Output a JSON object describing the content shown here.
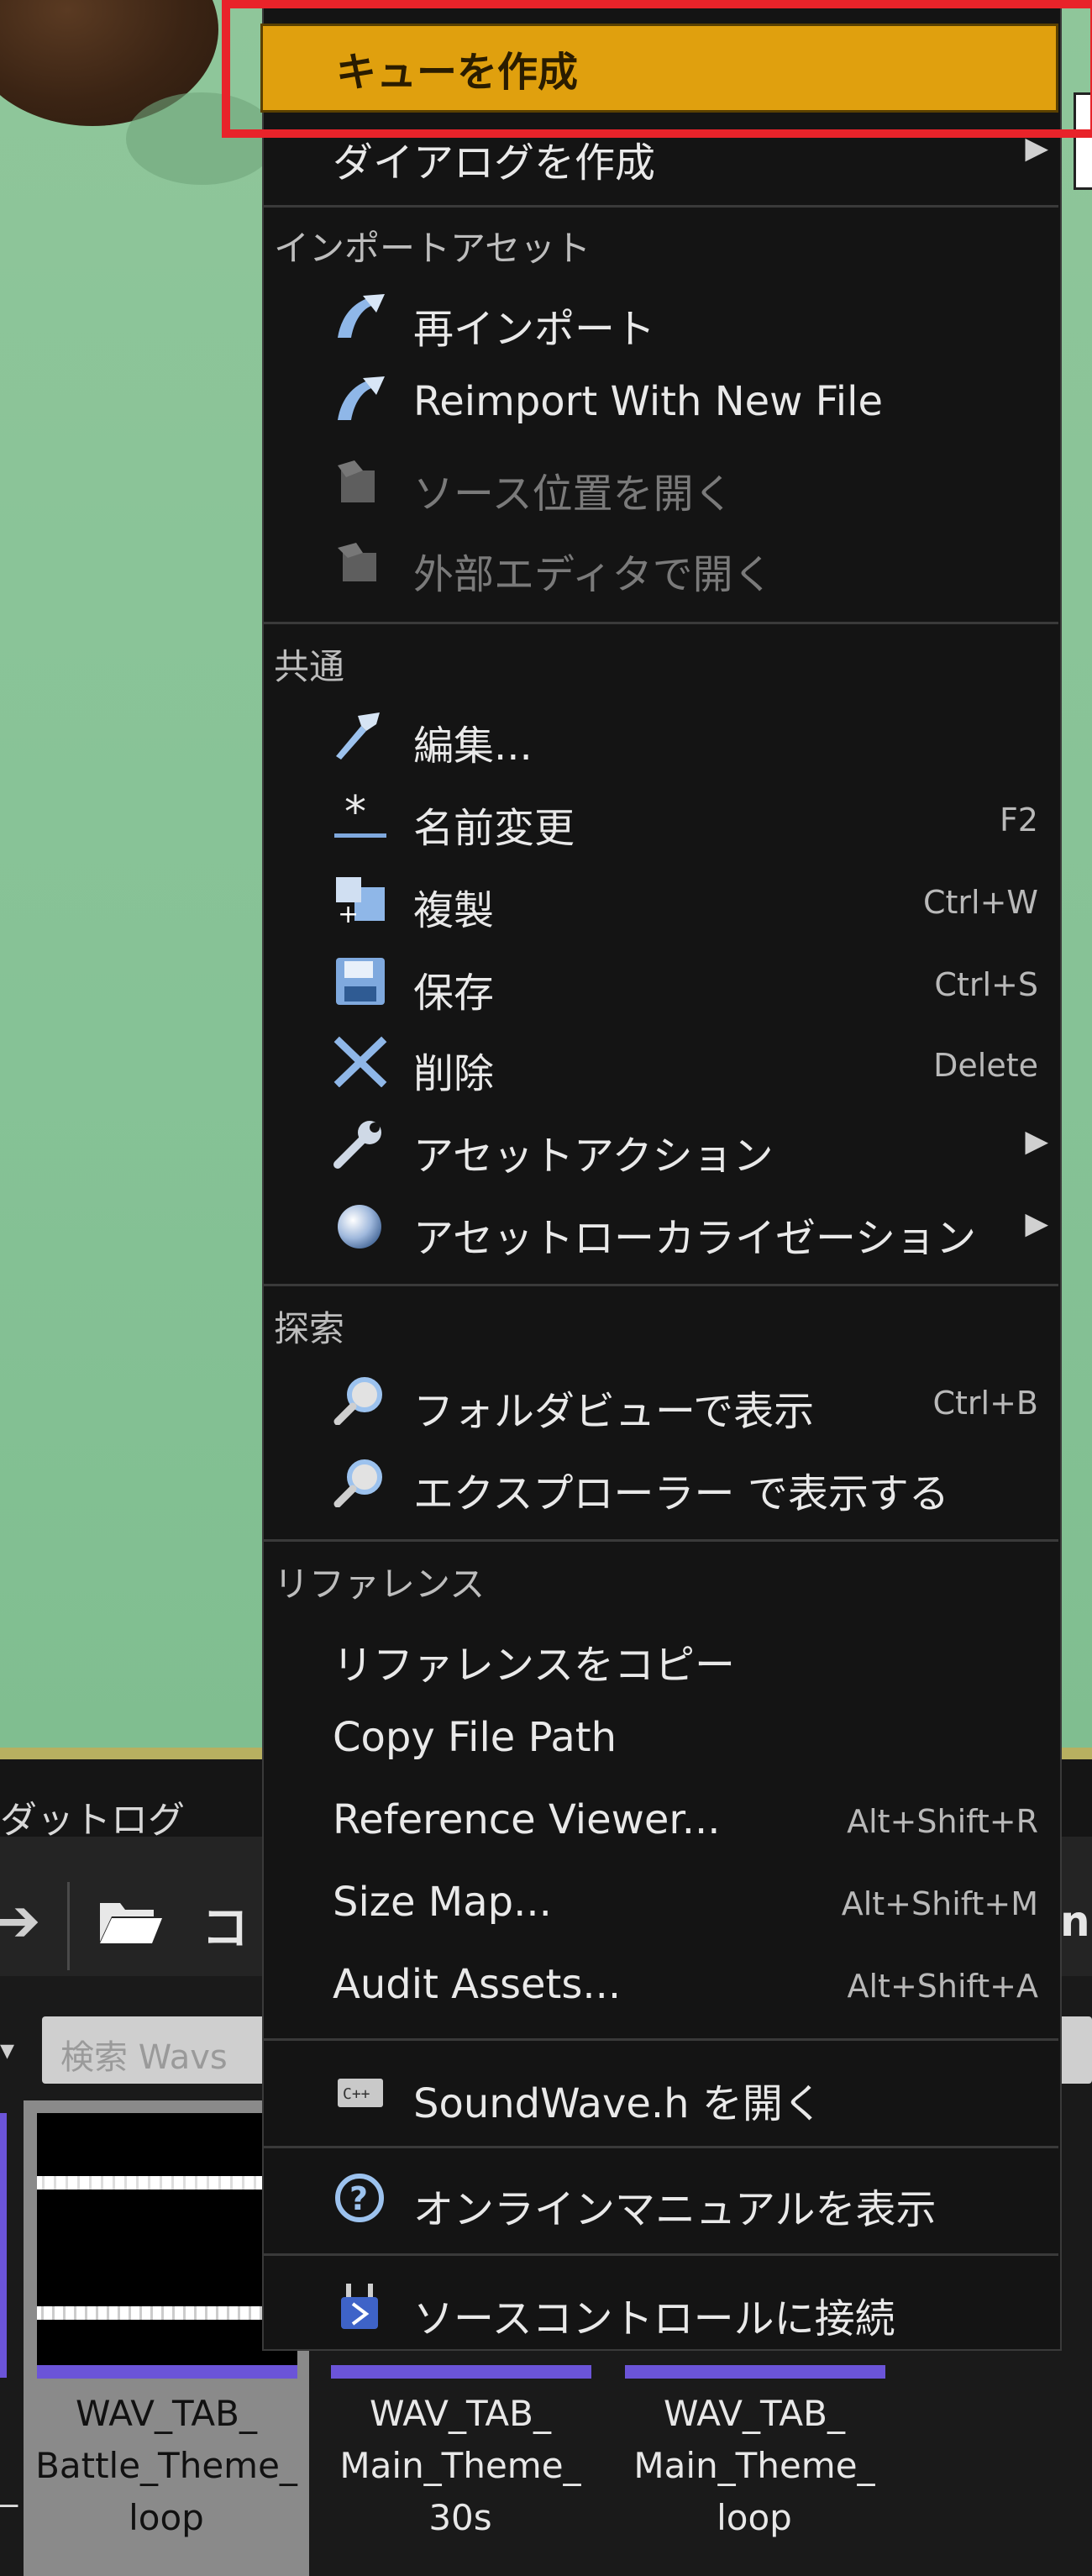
{
  "menu": {
    "highlighted": "キューを作成",
    "sections": [
      {
        "header": "",
        "items": [
          {
            "label": "ダイアログを作成",
            "shortcut": "",
            "submenu": true,
            "icon": "none",
            "disabled": false
          }
        ]
      },
      {
        "header": "インポートアセット",
        "items": [
          {
            "label": "再インポート",
            "shortcut": "",
            "submenu": false,
            "icon": "reimport-icon",
            "disabled": false
          },
          {
            "label": "Reimport With New File",
            "shortcut": "",
            "submenu": false,
            "icon": "reimport-icon",
            "disabled": false
          },
          {
            "label": "ソース位置を開く",
            "shortcut": "",
            "submenu": false,
            "icon": "open-source-icon",
            "disabled": true
          },
          {
            "label": "外部エディタで開く",
            "shortcut": "",
            "submenu": false,
            "icon": "external-editor-icon",
            "disabled": true
          }
        ]
      },
      {
        "header": "共通",
        "items": [
          {
            "label": "編集...",
            "shortcut": "",
            "submenu": false,
            "icon": "edit-icon",
            "disabled": false
          },
          {
            "label": "名前変更",
            "shortcut": "F2",
            "submenu": false,
            "icon": "rename-icon",
            "disabled": false
          },
          {
            "label": "複製",
            "shortcut": "Ctrl+W",
            "submenu": false,
            "icon": "duplicate-icon",
            "disabled": false
          },
          {
            "label": "保存",
            "shortcut": "Ctrl+S",
            "submenu": false,
            "icon": "save-icon",
            "disabled": false
          },
          {
            "label": "削除",
            "shortcut": "Delete",
            "submenu": false,
            "icon": "delete-icon",
            "disabled": false
          },
          {
            "label": "アセットアクション",
            "shortcut": "",
            "submenu": true,
            "icon": "wrench-icon",
            "disabled": false
          },
          {
            "label": "アセットローカライゼーション",
            "shortcut": "",
            "submenu": true,
            "icon": "globe-icon",
            "disabled": false
          }
        ]
      },
      {
        "header": "探索",
        "items": [
          {
            "label": "フォルダビューで表示",
            "shortcut": "Ctrl+B",
            "submenu": false,
            "icon": "magnifier-icon",
            "disabled": false
          },
          {
            "label": "エクスプローラー で表示する",
            "shortcut": "",
            "submenu": false,
            "icon": "magnifier-icon",
            "disabled": false
          }
        ]
      },
      {
        "header": "リファレンス",
        "items": [
          {
            "label": "リファレンスをコピー",
            "shortcut": "",
            "submenu": false,
            "icon": "none",
            "disabled": false
          },
          {
            "label": "Copy File Path",
            "shortcut": "",
            "submenu": false,
            "icon": "none",
            "disabled": false
          },
          {
            "label": "Reference Viewer...",
            "shortcut": "Alt+Shift+R",
            "submenu": false,
            "icon": "none",
            "disabled": false
          },
          {
            "label": "Size Map...",
            "shortcut": "Alt+Shift+M",
            "submenu": false,
            "icon": "none",
            "disabled": false
          },
          {
            "label": "Audit Assets...",
            "shortcut": "Alt+Shift+A",
            "submenu": false,
            "icon": "none",
            "disabled": false
          }
        ]
      },
      {
        "header": "",
        "items": [
          {
            "label": "SoundWave.h を開く",
            "shortcut": "",
            "submenu": false,
            "icon": "cpp-file-icon",
            "disabled": false
          }
        ]
      },
      {
        "header": "",
        "items": [
          {
            "label": "オンラインマニュアルを表示",
            "shortcut": "",
            "submenu": false,
            "icon": "help-icon",
            "disabled": false
          }
        ]
      },
      {
        "header": "",
        "items": [
          {
            "label": "ソースコントロールに接続",
            "shortcut": "",
            "submenu": false,
            "icon": "source-control-icon",
            "disabled": false
          }
        ]
      }
    ]
  },
  "panel": {
    "tab_label": "ダットログ",
    "toolbar_text": "コ",
    "toolbar_text_right": "ns",
    "search_placeholder": "検索 Wavs",
    "tiles": [
      {
        "line1": "WAV_TAB_",
        "line2": "Battle_Theme_",
        "line3": "loop",
        "selected": true
      },
      {
        "line1": "WAV_TAB_",
        "line2": "Main_Theme_",
        "line3": "30s",
        "selected": false
      },
      {
        "line1": "WAV_TAB_",
        "line2": "Main_Theme_",
        "line3": "loop",
        "selected": false
      }
    ],
    "left_edge_text": "_"
  },
  "colors": {
    "highlight_fill": "#e0a00e",
    "highlight_frame": "#e8232a",
    "menu_bg": "#141414",
    "viewport_green": "#8fc69a",
    "asset_bar": "#6b54d8"
  }
}
